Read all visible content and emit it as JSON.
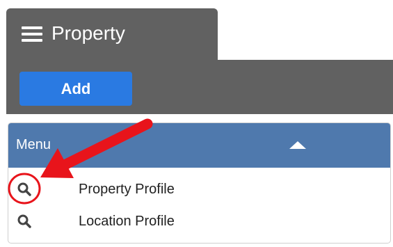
{
  "header": {
    "title": "Property",
    "menu_icon": "hamburger-icon"
  },
  "toolbar": {
    "add_label": "Add"
  },
  "menu": {
    "label": "Menu",
    "collapse_icon": "caret-up-icon",
    "items": [
      {
        "label": "Property Profile",
        "icon": "search-icon"
      },
      {
        "label": "Location Profile",
        "icon": "search-icon"
      }
    ]
  },
  "annotation": {
    "arrow_color": "#e8141b",
    "circle_color": "#e8141b"
  },
  "colors": {
    "header_bg": "#616161",
    "button": "#2a7ae2",
    "menu_header": "#4f79ad"
  }
}
